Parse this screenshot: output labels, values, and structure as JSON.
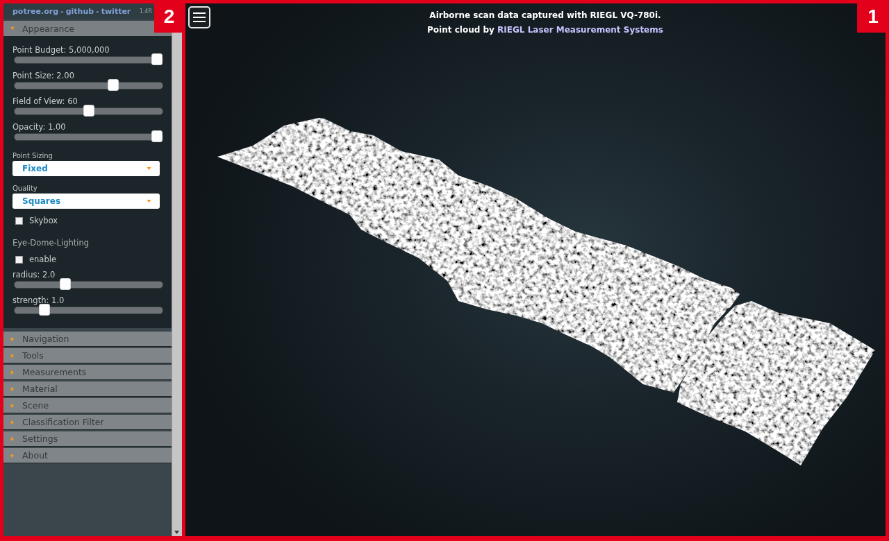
{
  "sidebar": {
    "callout": "2",
    "header": [
      {
        "kind": "link",
        "text": "potree.org"
      },
      {
        "kind": "separator",
        "text": "-"
      },
      {
        "kind": "link",
        "text": "github"
      },
      {
        "kind": "separator",
        "text": "-"
      },
      {
        "kind": "link",
        "text": "twitter"
      },
      {
        "kind": "version",
        "text": "1.4R"
      }
    ],
    "sections": [
      {
        "title": "Appearance",
        "expanded": true,
        "controls": [
          {
            "kind": "slider",
            "label": "Point Budget: 5,000,000",
            "level": 1
          },
          {
            "kind": "slider",
            "label": "Point Size: 2.00",
            "level": 0.68
          },
          {
            "kind": "slider",
            "label": "Field of View: 60",
            "level": 0.5
          },
          {
            "kind": "slider",
            "label": "Opacity: 1.00",
            "level": 1
          },
          {
            "kind": "select",
            "label": "Point Sizing",
            "value": "Fixed"
          },
          {
            "kind": "select",
            "label": "Quality",
            "value": "Squares"
          },
          {
            "kind": "checkbox",
            "label": "Skybox",
            "checked": false
          },
          {
            "kind": "heading",
            "label": "Eye-Dome-Lighting"
          },
          {
            "kind": "checkbox",
            "label": "enable",
            "checked": false
          },
          {
            "kind": "slider",
            "label": "radius: 2.0",
            "level": 0.33
          },
          {
            "kind": "slider",
            "label": "strength: 1.0",
            "level": 0.18
          }
        ]
      },
      {
        "title": "Navigation",
        "expanded": false
      },
      {
        "title": "Tools",
        "expanded": false
      },
      {
        "title": "Measurements",
        "expanded": false
      },
      {
        "title": "Material",
        "expanded": false
      },
      {
        "title": "Scene",
        "expanded": false
      },
      {
        "title": "Classification Filter",
        "expanded": false
      },
      {
        "title": "Settings",
        "expanded": false
      },
      {
        "title": "About",
        "expanded": false
      }
    ]
  },
  "viewer": {
    "callout": "1",
    "caption": "Airborne scan data captured with RIEGL VQ-780i.",
    "credit": {
      "text": "Point cloud by",
      "link": "RIEGL Laser Measurement Systems"
    }
  }
}
